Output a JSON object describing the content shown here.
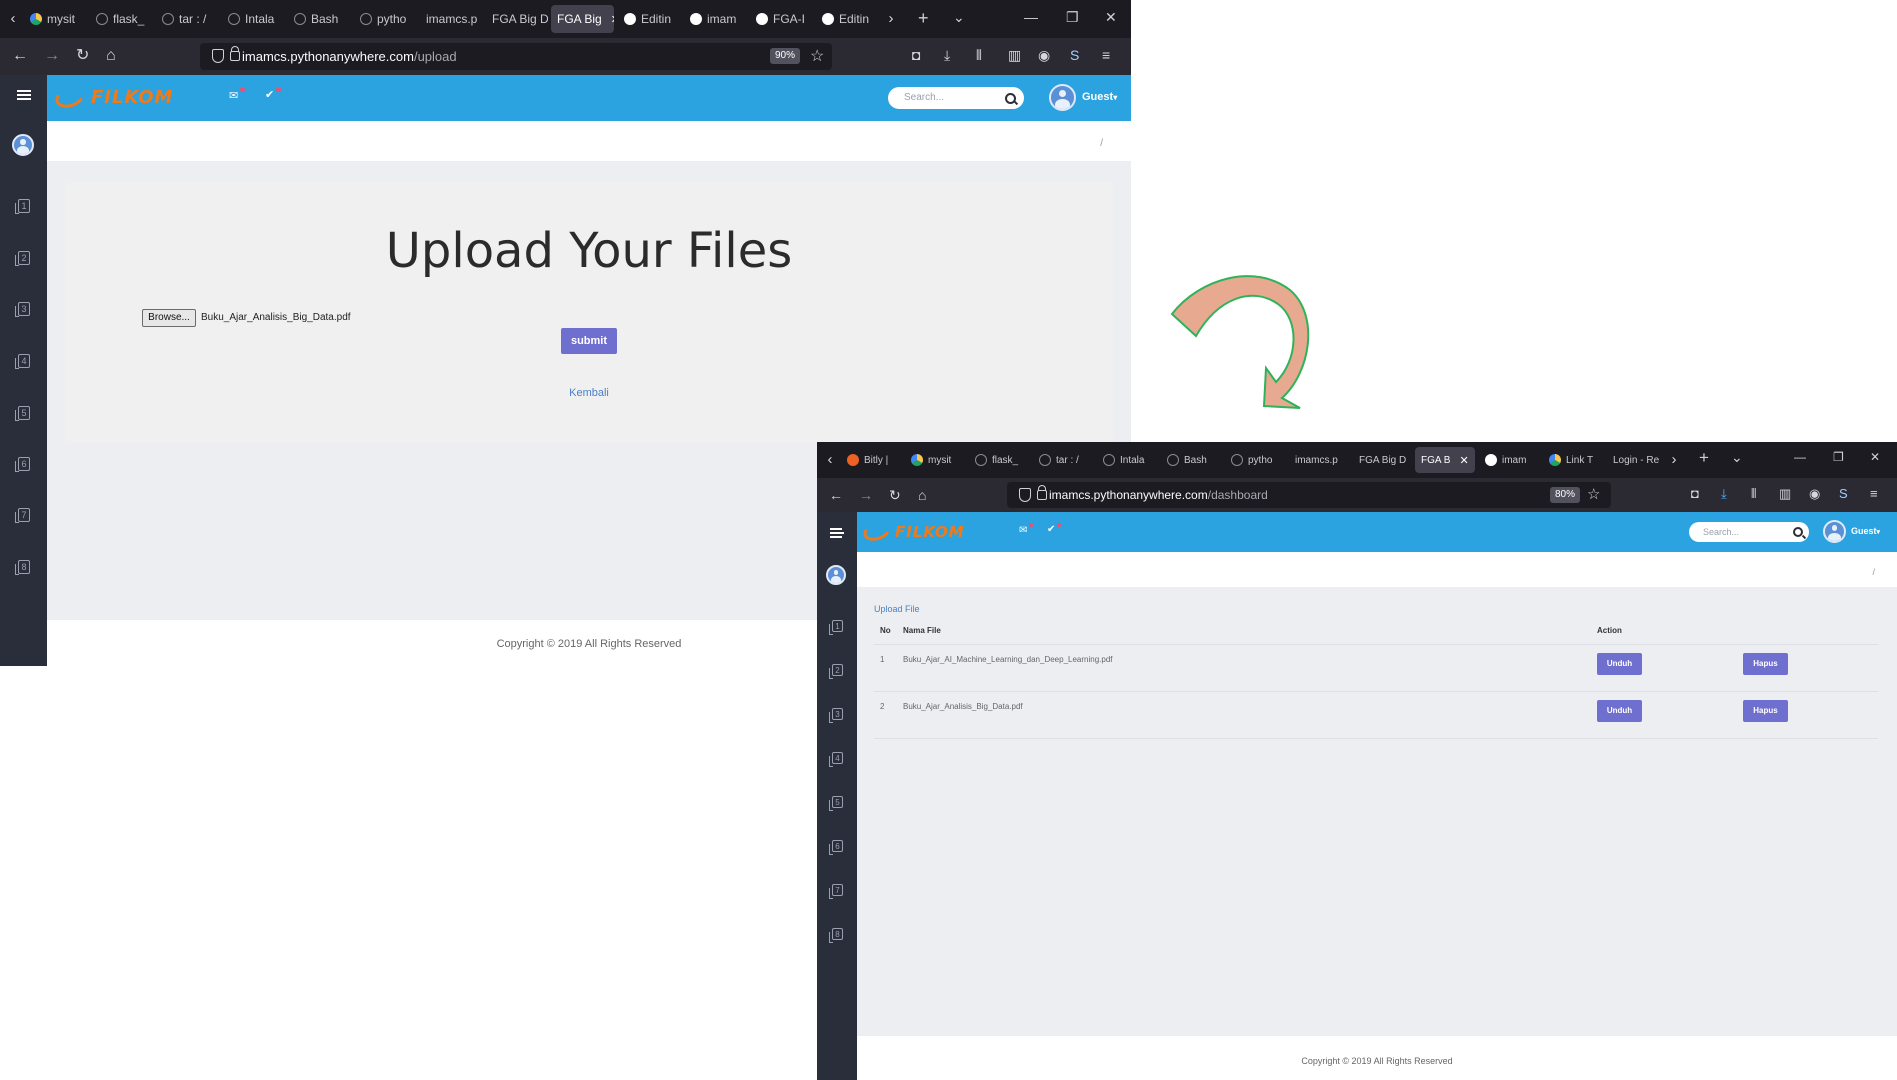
{
  "window1": {
    "tabs": [
      "mysit",
      "flask_",
      "tar : /",
      "Intala",
      "Bash",
      "pytho",
      "imamcs.p",
      "FGA Big D",
      "FGA Big",
      "Editin",
      "imam",
      "FGA-I",
      "Editin"
    ],
    "active_tab_index": 8,
    "url_host": "imamcs.pythonanywhere.com",
    "url_path": "/upload",
    "zoom": "90%",
    "brand": "FILKOM",
    "search_placeholder": "Search...",
    "user": "Guest",
    "breadcrumb_sep": "/",
    "sidebar_items": [
      "1",
      "2",
      "3",
      "4",
      "5",
      "6",
      "7",
      "8"
    ],
    "page": {
      "title": "Upload Your Files",
      "browse_label": "Browse...",
      "selected_file": "Buku_Ajar_Analisis_Big_Data.pdf",
      "submit_label": "submit",
      "back_link": "Kembali"
    },
    "footer": "Copyright © 2019 All Rights Reserved"
  },
  "window2": {
    "tabs": [
      "Bitly |",
      "mysit",
      "flask_",
      "tar : /",
      "Intala",
      "Bash",
      "pytho",
      "imamcs.p",
      "FGA Big D",
      "FGA B",
      "imam",
      "Link T",
      "Login - Re"
    ],
    "active_tab_index": 9,
    "url_host": "imamcs.pythonanywhere.com",
    "url_path": "/dashboard",
    "zoom": "80%",
    "brand": "FILKOM",
    "search_placeholder": "Search...",
    "user": "Guest",
    "breadcrumb_sep": "/",
    "sidebar_items": [
      "1",
      "2",
      "3",
      "4",
      "5",
      "6",
      "7",
      "8"
    ],
    "page": {
      "upload_link": "Upload File",
      "table": {
        "headers": [
          "No",
          "Nama File",
          "Action"
        ],
        "rows": [
          {
            "no": "1",
            "file": "Buku_Ajar_AI_Machine_Learning_dan_Deep_Learning.pdf",
            "download": "Unduh",
            "delete": "Hapus"
          },
          {
            "no": "2",
            "file": "Buku_Ajar_Analisis_Big_Data.pdf",
            "download": "Unduh",
            "delete": "Hapus"
          }
        ]
      }
    },
    "footer": "Copyright © 2019 All Rights Reserved"
  },
  "colors": {
    "topnav": "#2aa3e0",
    "sidebar": "#2a2d3a",
    "button": "#6f6fd0",
    "brand": "#ef7a1a",
    "arrow_fill": "#e7a98f",
    "arrow_stroke": "#2fb35a"
  }
}
